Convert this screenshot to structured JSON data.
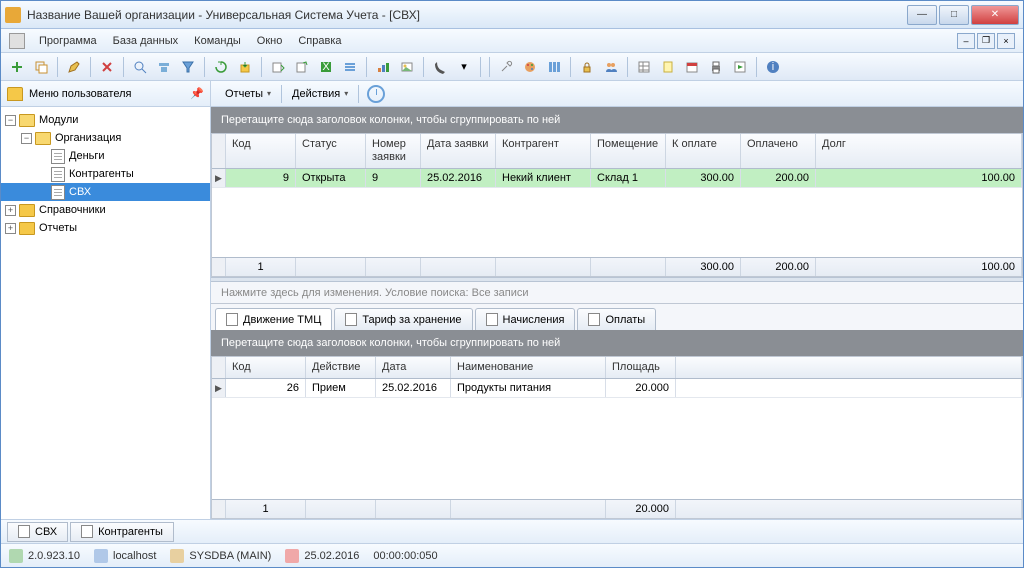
{
  "window": {
    "title": "Название Вашей организации - Универсальная Система Учета - [СВХ]"
  },
  "menu": {
    "items": [
      "Программа",
      "База данных",
      "Команды",
      "Окно",
      "Справка"
    ]
  },
  "usermenu": {
    "title": "Меню пользователя"
  },
  "tree": {
    "modules": "Модули",
    "organization": "Организация",
    "money": "Деньги",
    "contragents": "Контрагенты",
    "svh": "СВХ",
    "refs": "Справочники",
    "reports": "Отчеты"
  },
  "actions": {
    "reports": "Отчеты",
    "actions": "Действия"
  },
  "grid1": {
    "group_hint": "Перетащите сюда заголовок колонки, чтобы сгруппировать по ней",
    "headers": {
      "code": "Код",
      "status": "Статус",
      "reqno": "Номер заявки",
      "reqdate": "Дата заявки",
      "contragent": "Контрагент",
      "room": "Помещение",
      "topay": "К оплате",
      "paid": "Оплачено",
      "debt": "Долг"
    },
    "row": {
      "code": "9",
      "status": "Открыта",
      "reqno": "9",
      "reqdate": "25.02.2016",
      "contragent": "Некий клиент",
      "room": "Склад 1",
      "topay": "300.00",
      "paid": "200.00",
      "debt": "100.00"
    },
    "footer": {
      "count": "1",
      "topay": "300.00",
      "paid": "200.00",
      "debt": "100.00"
    }
  },
  "search": {
    "text": "Нажмите здесь для изменения. Условие поиска: Все записи"
  },
  "tabs": {
    "t1": "Движение ТМЦ",
    "t2": "Тариф за хранение",
    "t3": "Начисления",
    "t4": "Оплаты"
  },
  "grid2": {
    "group_hint": "Перетащите сюда заголовок колонки, чтобы сгруппировать по ней",
    "headers": {
      "code": "Код",
      "action": "Действие",
      "date": "Дата",
      "name": "Наименование",
      "area": "Площадь"
    },
    "row": {
      "code": "26",
      "action": "Прием",
      "date": "25.02.2016",
      "name": "Продукты питания",
      "area": "20.000"
    },
    "footer": {
      "count": "1",
      "area": "20.000"
    }
  },
  "bottom_tabs": {
    "t1": "СВХ",
    "t2": "Контрагенты"
  },
  "status": {
    "version": "2.0.923.10",
    "server": "localhost",
    "user": "SYSDBA (MAIN)",
    "date": "25.02.2016",
    "time": "00:00:00:050"
  }
}
